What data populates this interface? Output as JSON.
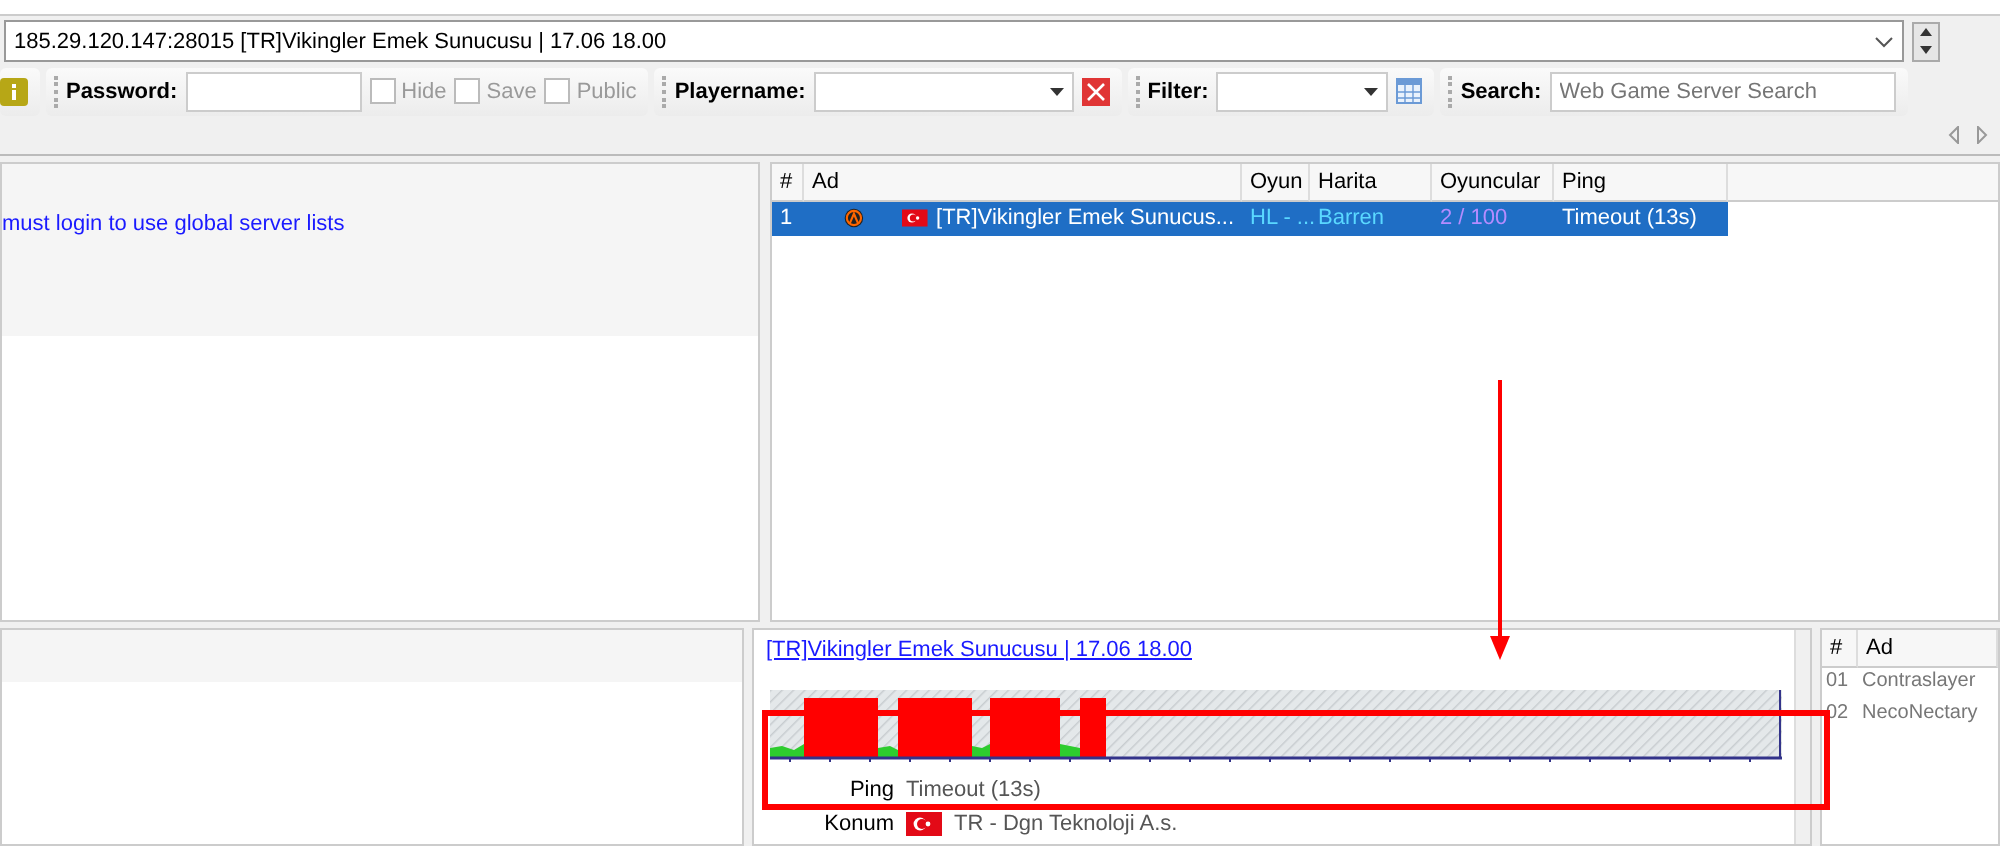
{
  "address_bar": {
    "value": "185.29.120.147:28015 [TR]Vikingler Emek Sunucusu | 17.06 18.00"
  },
  "toolbar": {
    "password": {
      "label": "Password:"
    },
    "options": [
      {
        "label": "Hide",
        "checked": false
      },
      {
        "label": "Save",
        "checked": false
      },
      {
        "label": "Public",
        "checked": false
      }
    ],
    "playername": {
      "label": "Playername:"
    },
    "filter": {
      "label": "Filter:"
    },
    "search": {
      "label": "Search:",
      "placeholder": "Web Game Server Search"
    }
  },
  "server_list_panel": {
    "message": "must login to use global server lists"
  },
  "servers": {
    "columns": [
      "#",
      "Ad",
      "Oyun",
      "Harita",
      "Oyuncular",
      "Ping"
    ],
    "rows": [
      {
        "number": "1",
        "name": "[TR]Vikingler Emek Sunucus...",
        "game": "HL - ...",
        "map": "Barren",
        "players": "2 / 100",
        "ping": "Timeout (13s)",
        "selected": true
      }
    ]
  },
  "details": {
    "title_link": "[TR]Vikingler Emek Sunucusu | 17.06 18.00",
    "info": [
      {
        "label": "Ping",
        "value": "Timeout (13s)"
      },
      {
        "label": "Konum",
        "value": "TR - Dgn Teknoloji A.s."
      }
    ]
  },
  "players": {
    "columns": [
      "#",
      "Ad"
    ],
    "rows": [
      {
        "number": "01",
        "name": "Contraslayer"
      },
      {
        "number": "02",
        "name": "NecoNectary"
      }
    ]
  }
}
